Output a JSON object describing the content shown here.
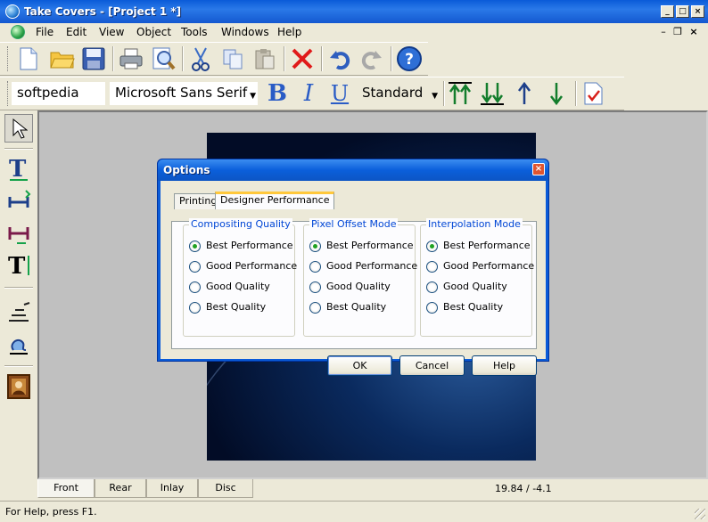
{
  "window": {
    "title": "Take Covers - [Project 1 *]",
    "minimize": "_",
    "maximize": "□",
    "close": "×"
  },
  "menubar": {
    "items": [
      "File",
      "Edit",
      "View",
      "Object",
      "Tools",
      "Windows",
      "Help"
    ],
    "mdi_minimize": "–",
    "mdi_restore": "❐",
    "mdi_close": "×"
  },
  "text_toolbar": {
    "text_value": "softpedia",
    "font_value": "Microsoft Sans Serif",
    "style_value": "Standard",
    "bold": "B",
    "italic": "I",
    "underline": "U"
  },
  "bottom_tabs": [
    "Front",
    "Rear",
    "Inlay",
    "Disc"
  ],
  "coordinates": "19.84 / -4.1",
  "status": {
    "text": "For Help, press F1."
  },
  "dialog": {
    "title": "Options",
    "close": "×",
    "tabs": [
      "Printing",
      "Designer Performance"
    ],
    "groups": [
      {
        "label": "Compositing Quality",
        "options": [
          "Best Performance",
          "Good Performance",
          "Good Quality",
          "Best Quality"
        ],
        "selected": 0
      },
      {
        "label": "Pixel Offset Mode",
        "options": [
          "Best Performance",
          "Good Performance",
          "Good Quality",
          "Best Quality"
        ],
        "selected": 0
      },
      {
        "label": "Interpolation Mode",
        "options": [
          "Best Performance",
          "Good Performance",
          "Good Quality",
          "Best Quality"
        ],
        "selected": 0
      }
    ],
    "buttons": {
      "ok": "OK",
      "cancel": "Cancel",
      "help": "Help"
    }
  },
  "colors": {
    "title_bar": "#0a5bd8",
    "dialog_tab_highlight": "#ffc83c",
    "radio_selected": "#21a121",
    "group_label": "#0046d5"
  }
}
